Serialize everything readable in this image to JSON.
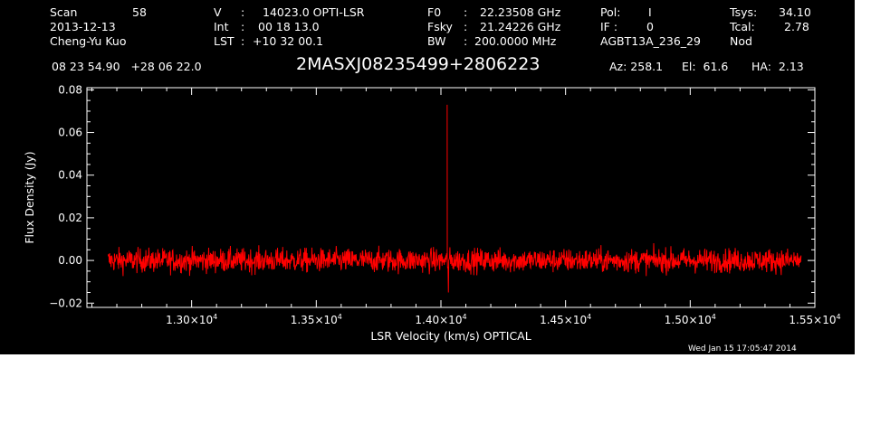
{
  "header": {
    "scan_label": "Scan",
    "scan_value": "58",
    "date": "2013-12-13",
    "observer": "Cheng-Yu Kuo",
    "v_label": "V",
    "v_value": "14023.0 OPTI-LSR",
    "int_label": "Int",
    "int_value": "00 18 13.0",
    "lst_label": "LST",
    "lst_value": "+10 32 00.1",
    "f0_label": "F0",
    "f0_value": "22.23508 GHz",
    "fsky_label": "Fsky",
    "fsky_value": "21.24226 GHz",
    "bw_label": "BW",
    "bw_value": "200.0000 MHz",
    "pol_label": "Pol:",
    "pol_value": "I",
    "if_label": "IF :",
    "if_value": "0",
    "project": "AGBT13A_236_29",
    "tsys_label": "Tsys:",
    "tsys_value": "34.10",
    "tcal_label": "Tcal:",
    "tcal_value": "2.78",
    "mode": "Nod",
    "coords": "08 23 54.90   +28 06 22.0",
    "source": "2MASXJ08235499+2806223",
    "az": "Az: 258.1",
    "el": "El:  61.6",
    "ha": "HA:  2.13"
  },
  "footer": {
    "timestamp": "Wed Jan 15 17:05:47 2014"
  },
  "colors": {
    "background": "#000000",
    "axes": "#ffffff",
    "trace": "#ff0000"
  },
  "chart_data": {
    "type": "line",
    "xlabel": "LSR Velocity (km/s) OPTICAL",
    "ylabel": "Flux Density (Jy)",
    "xlim": [
      12580,
      15500
    ],
    "ylim": [
      -0.022,
      0.081
    ],
    "x_ticks": [
      {
        "value": 13000,
        "mantissa": "1.30",
        "exp": "4"
      },
      {
        "value": 13500,
        "mantissa": "1.35",
        "exp": "4"
      },
      {
        "value": 14000,
        "mantissa": "1.40",
        "exp": "4"
      },
      {
        "value": 14500,
        "mantissa": "1.45",
        "exp": "4"
      },
      {
        "value": 15000,
        "mantissa": "1.50",
        "exp": "4"
      },
      {
        "value": 15500,
        "mantissa": "1.55",
        "exp": "4"
      }
    ],
    "y_ticks": [
      {
        "value": -0.02,
        "label": "−0.02"
      },
      {
        "value": 0.0,
        "label": "0.00"
      },
      {
        "value": 0.02,
        "label": "0.02"
      },
      {
        "value": 0.04,
        "label": "0.04"
      },
      {
        "value": 0.06,
        "label": "0.06"
      },
      {
        "value": 0.08,
        "label": "0.08"
      }
    ],
    "series": [
      {
        "x_range": [
          12665,
          15445
        ],
        "baseline": 0.0,
        "noise_amplitude": 0.0055,
        "peak": {
          "x": 14025,
          "y": 0.073
        },
        "dip": {
          "x": 14030,
          "y": -0.015
        }
      }
    ]
  }
}
